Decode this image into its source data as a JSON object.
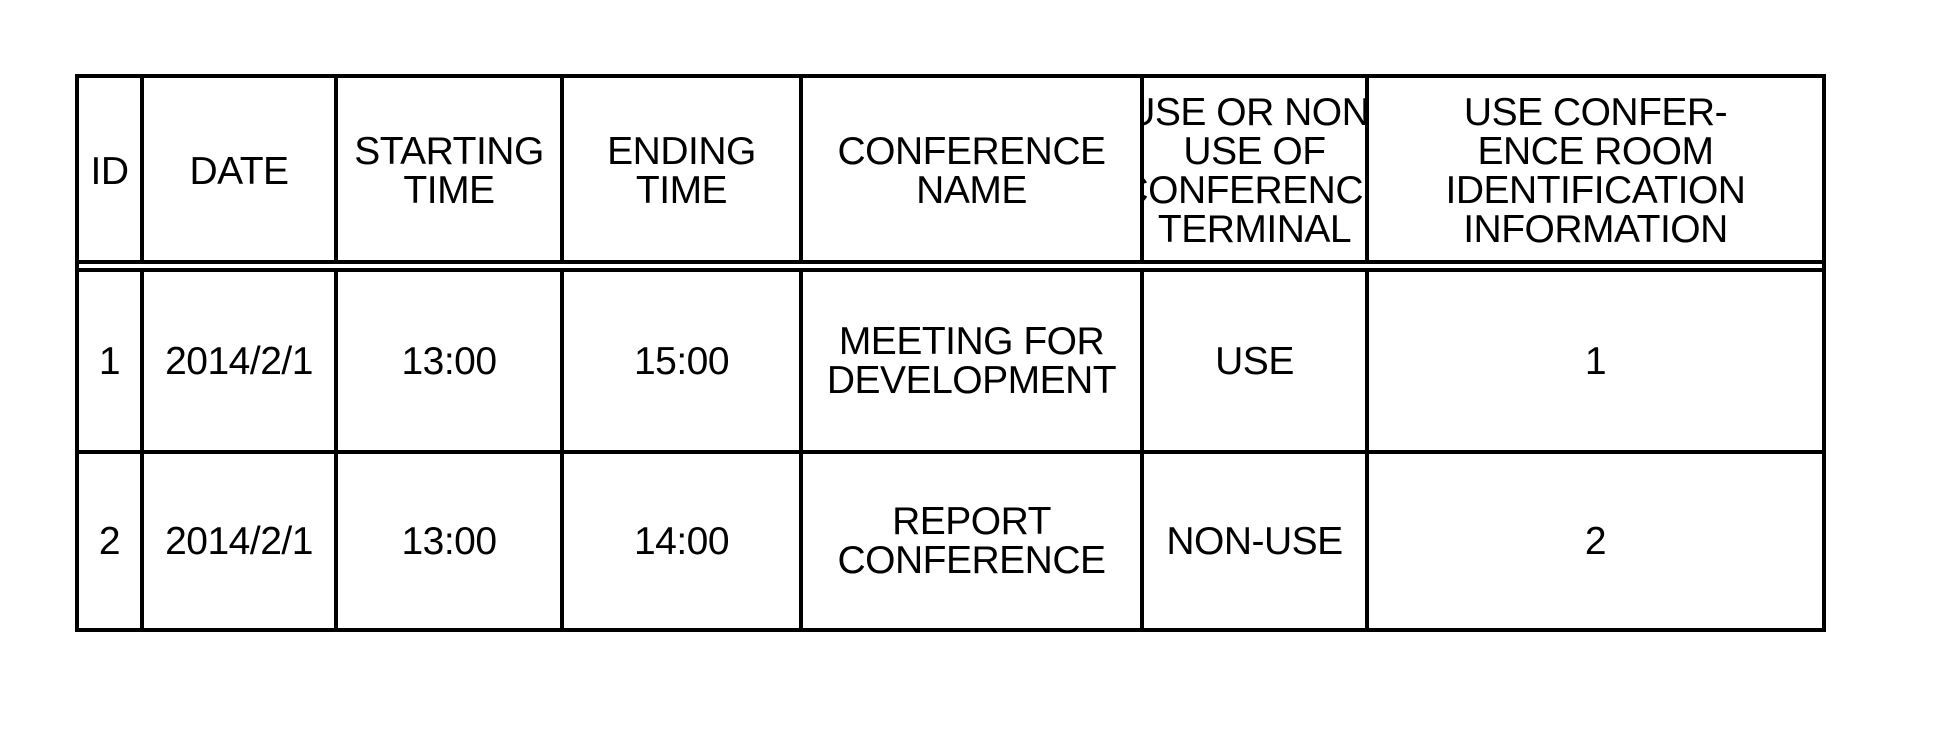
{
  "table": {
    "columns": [
      "ID",
      "DATE",
      "STARTING\nTIME",
      "ENDING\nTIME",
      "CONFERENCE\nNAME",
      "USE OR NON-\nUSE OF\nCONFERENCE\nTERMINAL",
      "USE CONFER-\nENCE ROOM\nIDENTIFICATION\nINFORMATION"
    ],
    "rows": [
      {
        "id": "1",
        "date": "2014/2/1",
        "starting_time": "13:00",
        "ending_time": "15:00",
        "conference_name": "MEETING FOR\nDEVELOPMENT",
        "terminal_use": "USE",
        "room_id": "1"
      },
      {
        "id": "2",
        "date": "2014/2/1",
        "starting_time": "13:00",
        "ending_time": "14:00",
        "conference_name": "REPORT\nCONFERENCE",
        "terminal_use": "NON-USE",
        "room_id": "2"
      }
    ]
  }
}
